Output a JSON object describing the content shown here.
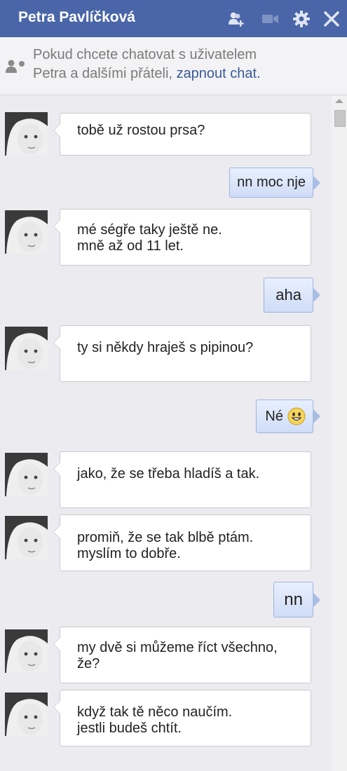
{
  "header": {
    "title": "Petra Pavlíčková",
    "icons": [
      "add-friend-icon",
      "video-call-icon",
      "gear-icon",
      "close-icon"
    ]
  },
  "notice": {
    "line1": "Pokud chcete chatovat s uživatelem",
    "line2_a": "Petra",
    "line2_b": "a dalšími přáteli,",
    "link": "zapnout chat."
  },
  "messages": [
    {
      "from": "Petra",
      "lines": [
        "tobě už rostou prsa?"
      ]
    },
    {
      "from": "me",
      "text": "nn moc nje"
    },
    {
      "from": "Petra",
      "lines": [
        "mé ségře taky ještě ne.",
        "mně až od 11 let."
      ]
    },
    {
      "from": "me",
      "text": "aha"
    },
    {
      "from": "Petra",
      "lines": [
        "ty si někdy hraješ s pipinou?"
      ]
    },
    {
      "from": "me",
      "text": "Né",
      "emoji": "smiley-icon"
    },
    {
      "from": "Petra",
      "lines": [
        "jako, že se třeba hladíš a tak."
      ]
    },
    {
      "from": "Petra",
      "lines": [
        "promiň, že se tak blbě ptám.",
        "myslím to dobře."
      ]
    },
    {
      "from": "me",
      "text": "nn"
    },
    {
      "from": "Petra",
      "lines": [
        "my dvě si můžeme říct všechno,",
        "že?"
      ]
    },
    {
      "from": "Petra",
      "lines": [
        "když tak tě něco naučím.",
        "jestli budeš chtít."
      ]
    }
  ],
  "colors": {
    "header": "#4a66a8",
    "link": "#3b5998",
    "outgoing_bubble": "#d6e2f8",
    "background": "#ebebf0"
  }
}
